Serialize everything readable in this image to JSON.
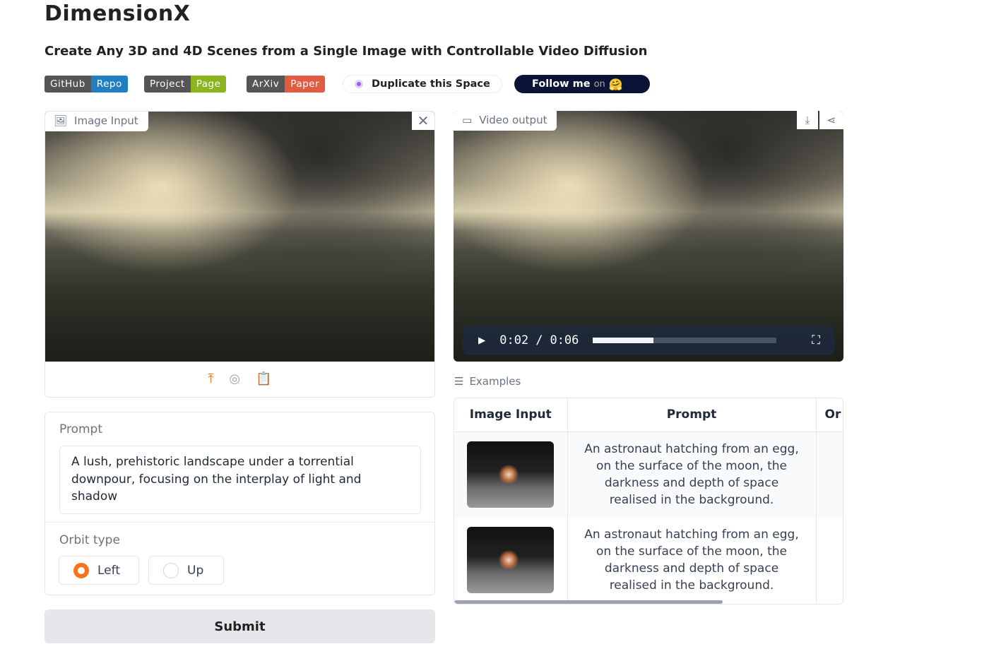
{
  "header": {
    "title": "DimensionX",
    "subtitle": "Create Any 3D and 4D Scenes from a Single Image with Controllable Video Diffusion"
  },
  "badges": [
    {
      "left": "GitHub",
      "right": "Repo",
      "color": "#1f7fc1"
    },
    {
      "left": "Project",
      "right": "Page",
      "color": "#8ab51f"
    },
    {
      "left": "ArXiv",
      "right": "Paper",
      "color": "#e05d44"
    }
  ],
  "duplicate_label": "Duplicate this Space",
  "follow": {
    "label": "Follow me",
    "on": "on"
  },
  "image_input": {
    "label": "Image Input"
  },
  "video_output": {
    "label": "Video output",
    "current_time": "0:02",
    "separator": "/",
    "duration": "0:06",
    "progress": 0.33
  },
  "prompt": {
    "label": "Prompt",
    "value": "A lush, prehistoric landscape under a torrential downpour, focusing on the interplay of light and shadow"
  },
  "orbit": {
    "label": "Orbit type",
    "options": [
      "Left",
      "Up"
    ],
    "selected": "Left"
  },
  "submit_label": "Submit",
  "examples": {
    "label": "Examples",
    "headers": [
      "Image Input",
      "Prompt",
      "Or"
    ],
    "rows": [
      {
        "prompt": "An astronaut hatching from an egg, on the surface of the moon, the darkness and depth of space realised in the background."
      },
      {
        "prompt": "An astronaut hatching from an egg, on the surface of the moon, the darkness and depth of space realised in the background."
      }
    ]
  },
  "colors": {
    "accent": "#f97316",
    "follow_bg": "#0b1437"
  }
}
